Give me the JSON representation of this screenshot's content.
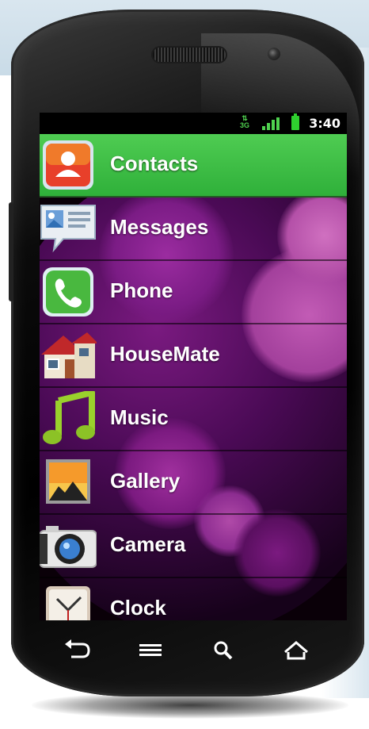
{
  "status_bar": {
    "network": "3G",
    "time": "3:40",
    "colors": {
      "indicator": "#4fd14f"
    }
  },
  "app_list": [
    {
      "label": "Contacts",
      "icon": "contacts-icon",
      "selected": true
    },
    {
      "label": "Messages",
      "icon": "messages-icon",
      "selected": false
    },
    {
      "label": "Phone",
      "icon": "phone-icon",
      "selected": false
    },
    {
      "label": "HouseMate",
      "icon": "house-icon",
      "selected": false
    },
    {
      "label": "Music",
      "icon": "music-note-icon",
      "selected": false
    },
    {
      "label": "Gallery",
      "icon": "gallery-icon",
      "selected": false
    },
    {
      "label": "Camera",
      "icon": "camera-icon",
      "selected": false
    },
    {
      "label": "Clock",
      "icon": "clock-icon",
      "selected": false
    }
  ],
  "nav_bar": {
    "buttons": [
      "back-icon",
      "menu-icon",
      "search-icon",
      "home-icon"
    ]
  },
  "colors": {
    "selected_row": "#3dbd44",
    "wallpaper": "#5a1060"
  }
}
